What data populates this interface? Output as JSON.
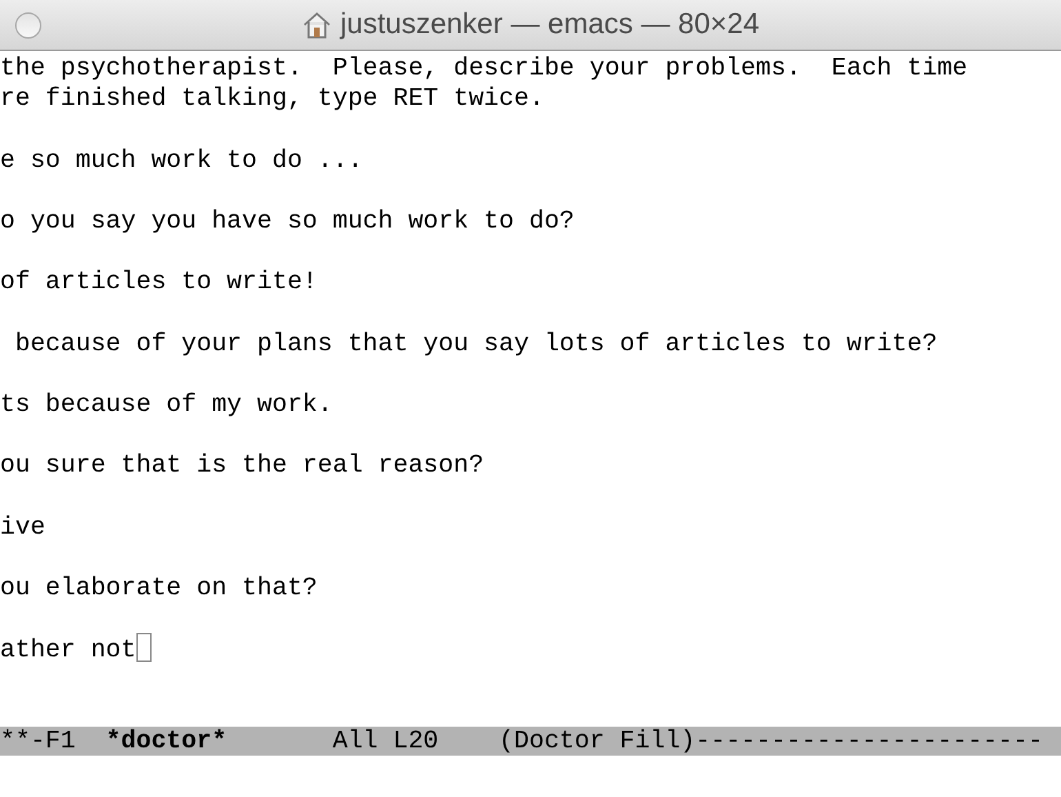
{
  "window": {
    "title": "justuszenker — emacs — 80×24"
  },
  "buffer": {
    "paragraphs": [
      [
        "the psychotherapist.  Please, describe your problems.  Each time",
        "re finished talking, type RET twice."
      ],
      [
        "e so much work to do ..."
      ],
      [
        "o you say you have so much work to do?"
      ],
      [
        "of articles to write!"
      ],
      [
        " because of your plans that you say lots of articles to write?"
      ],
      [
        "ts because of my work."
      ],
      [
        "ou sure that is the real reason?"
      ],
      [
        "ive"
      ],
      [
        "ou elaborate on that?"
      ],
      [
        "ather not"
      ]
    ],
    "cursor": true
  },
  "mode_line": {
    "segments": [
      {
        "text": "**-F1  ",
        "bold": false
      },
      {
        "text": "*doctor*",
        "bold": true
      },
      {
        "text": "       All L20    (Doctor Fill)-----------------------",
        "bold": false
      }
    ]
  }
}
